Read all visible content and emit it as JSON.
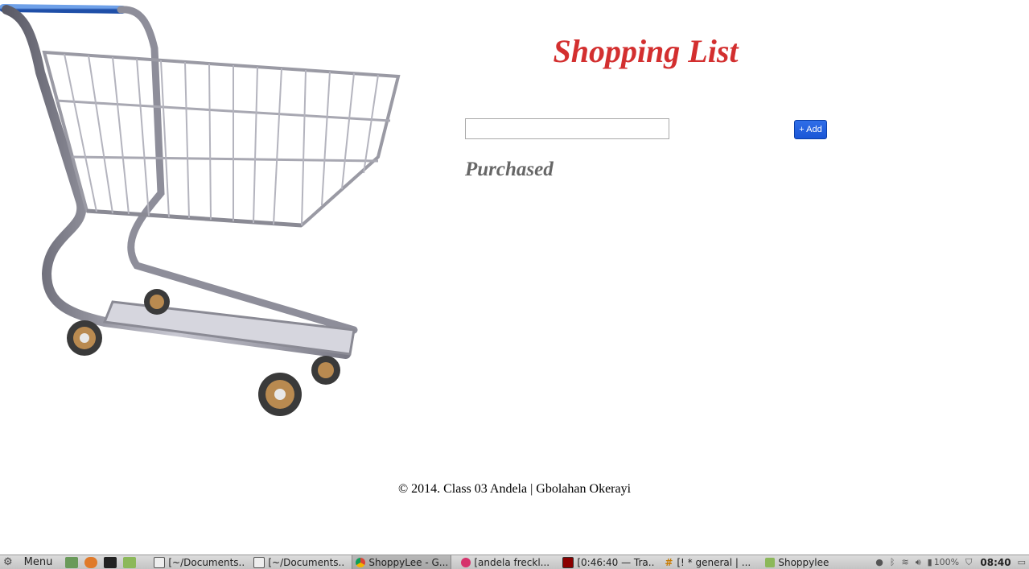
{
  "page": {
    "title": "Shopping List",
    "input_value": "",
    "add_label": "+ Add",
    "purchased_heading": "Purchased",
    "footer": "© 2014. Class 03 Andela | Gbolahan Okerayi"
  },
  "taskbar": {
    "menu_label": "Menu",
    "tasks": [
      {
        "label": "[~/Documents..."
      },
      {
        "label": "[~/Documents..."
      },
      {
        "label": "ShoppyLee - G..."
      },
      {
        "label": "[andela freckl..."
      },
      {
        "label": "[0:46:40 — Tra..."
      },
      {
        "label": "[! * general | ..."
      },
      {
        "label": "Shoppylee"
      }
    ],
    "battery": "100%",
    "clock": "08:40"
  },
  "colors": {
    "title": "#d32f2f",
    "purchased": "#666666",
    "button": "#1a56d6"
  }
}
